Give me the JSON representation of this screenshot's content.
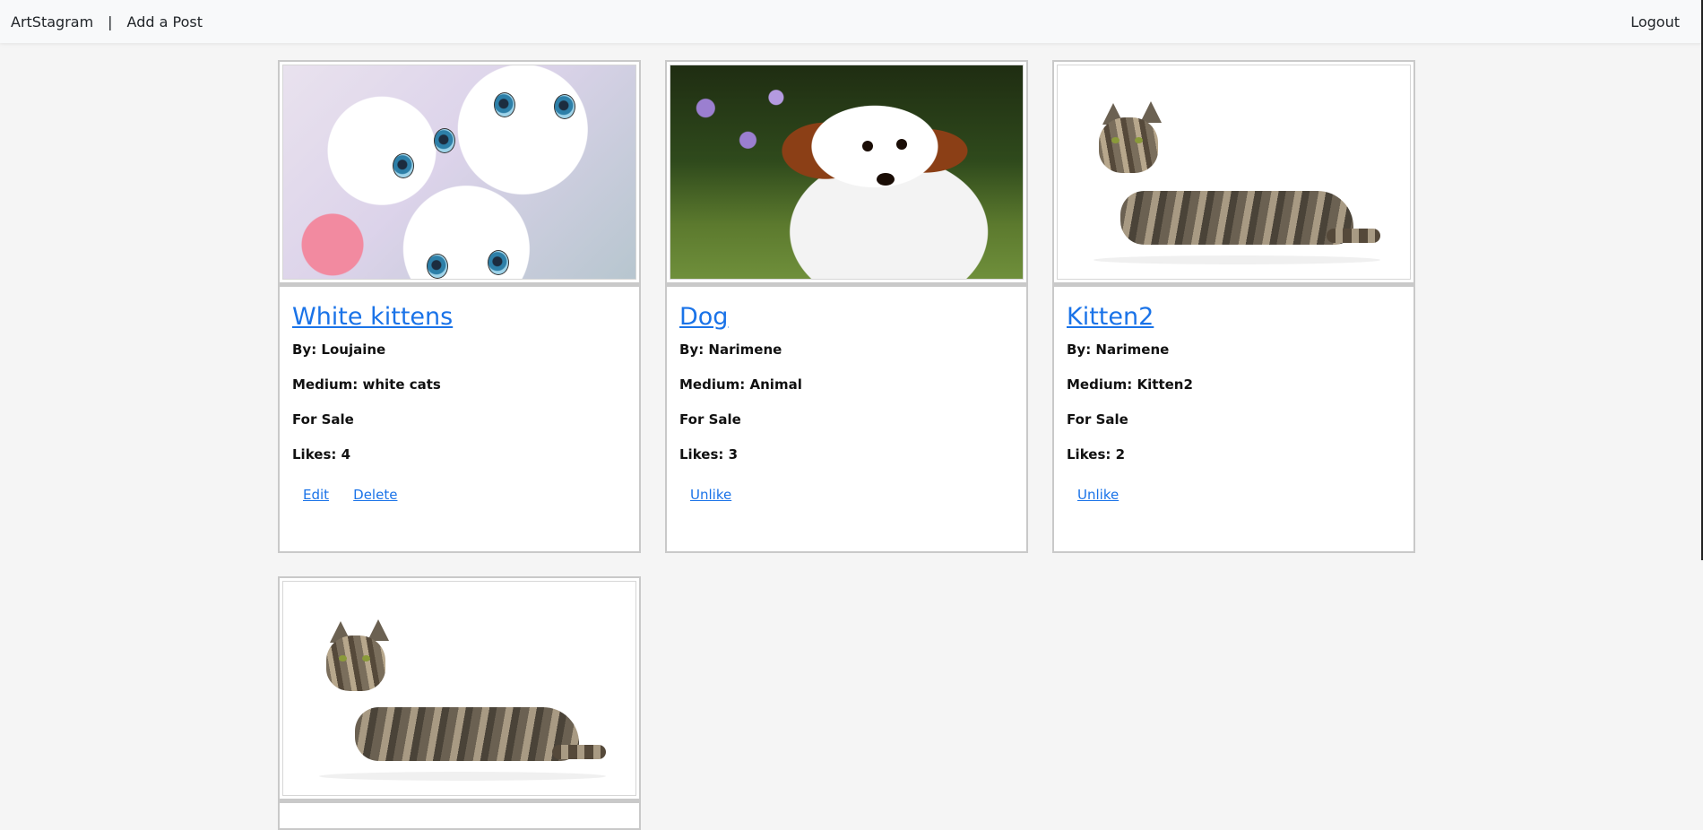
{
  "nav": {
    "brand": "ArtStagram",
    "separator": "|",
    "add_post": "Add a Post",
    "logout": "Logout"
  },
  "posts": [
    {
      "title": "White kittens",
      "by": "By: Loujaine",
      "medium": "Medium: white cats",
      "sale": "For Sale",
      "likes": "Likes: 4",
      "actions": [
        "Edit",
        "Delete"
      ]
    },
    {
      "title": "Dog",
      "by": "By: Narimene",
      "medium": "Medium: Animal",
      "sale": "For Sale",
      "likes": "Likes: 3",
      "actions": [
        "Unlike"
      ]
    },
    {
      "title": "Kitten2",
      "by": "By: Narimene",
      "medium": "Medium: Kitten2",
      "sale": "For Sale",
      "likes": "Likes: 2",
      "actions": [
        "Unlike"
      ]
    }
  ],
  "colors": {
    "link": "#1a73e8",
    "background": "#f5f5f5",
    "navbar": "#f8f9fa",
    "card_border": "#c9c9c9"
  }
}
